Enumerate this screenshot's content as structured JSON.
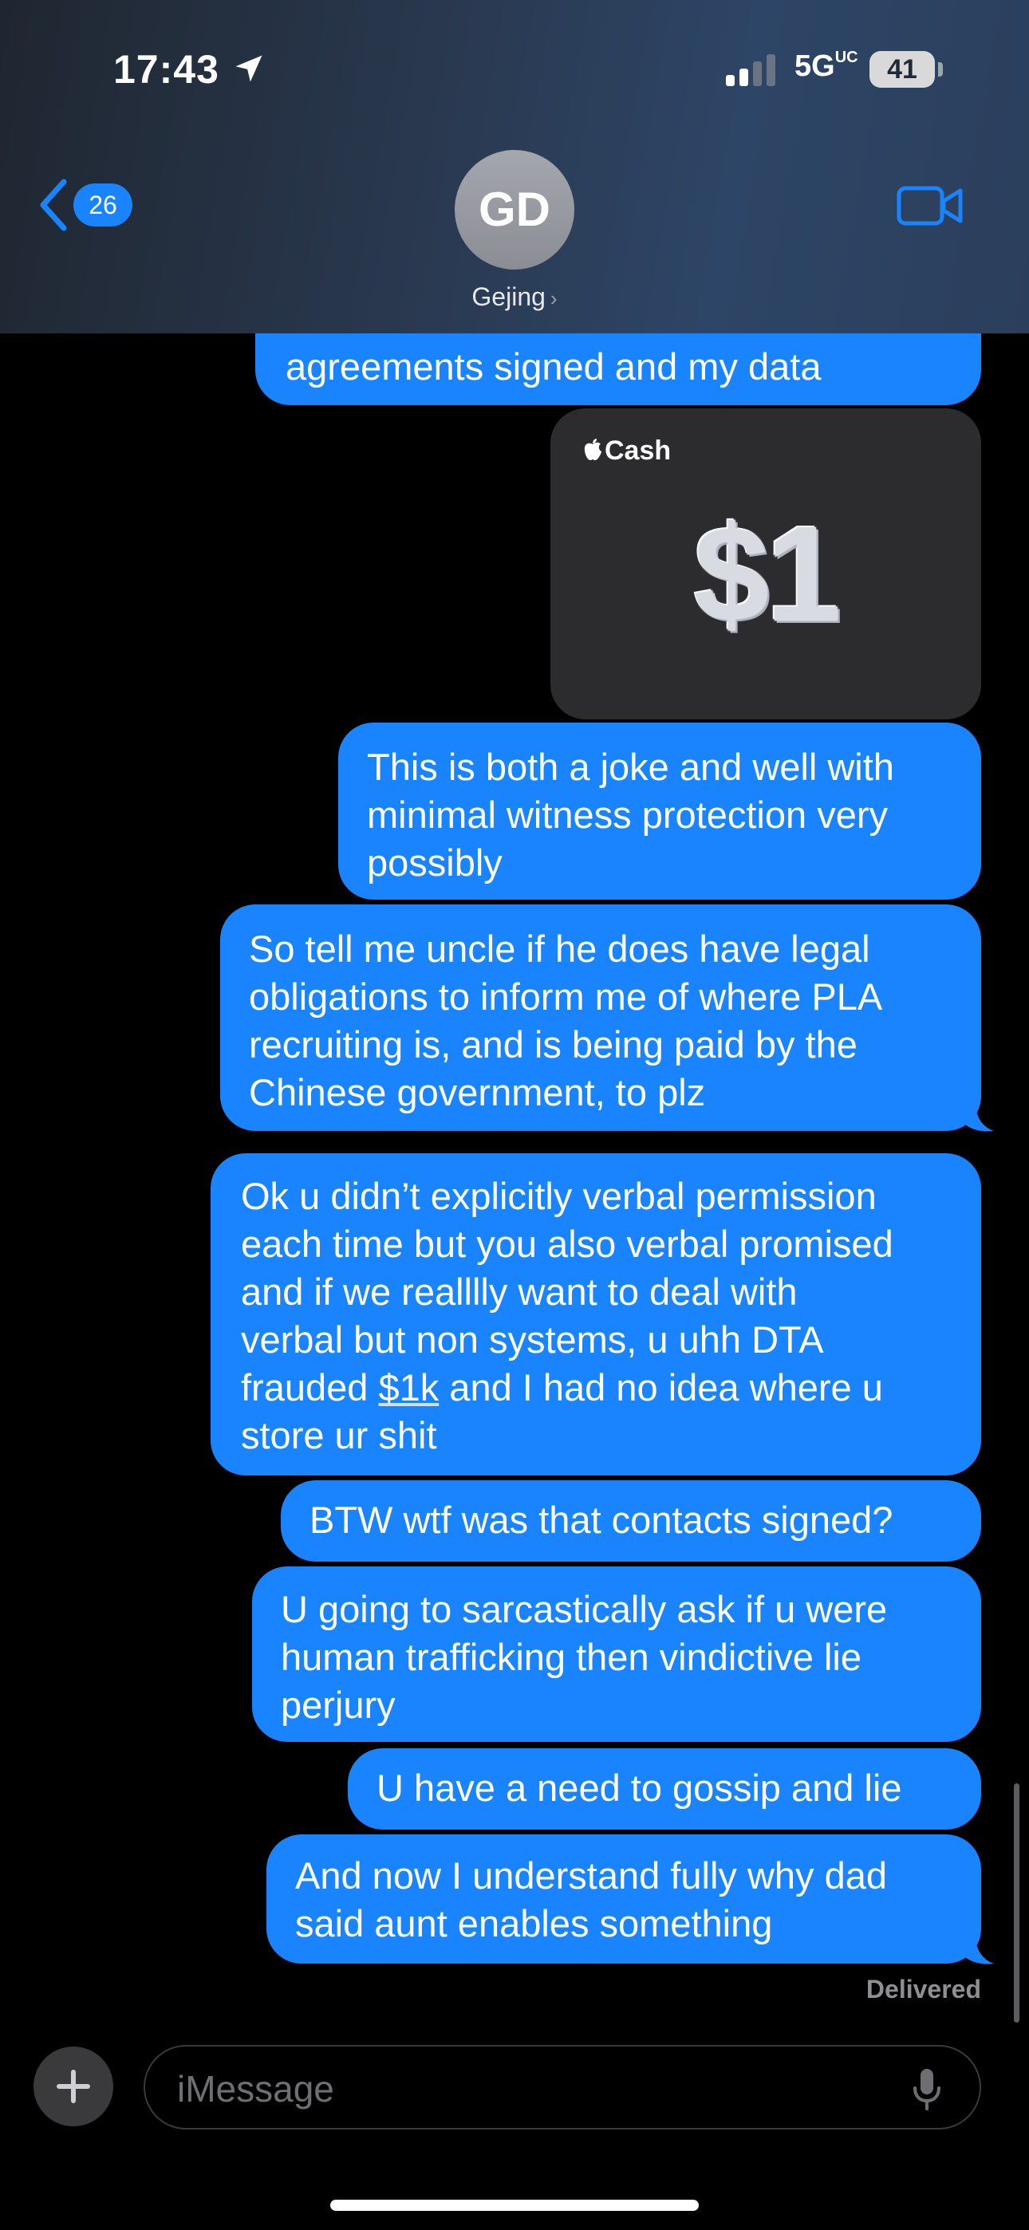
{
  "status_bar": {
    "time": "17:43",
    "network": "5G",
    "network_sub": "UC",
    "battery": "41"
  },
  "header": {
    "back_count": "26",
    "avatar_initials": "GD",
    "contact_name": "Gejing",
    "contact_chevron": "›"
  },
  "messages": {
    "m0": [
      "agreements signed and my data"
    ],
    "cash": {
      "label": "Cash",
      "amount": "$1"
    },
    "m1": [
      "This is both a joke and well with",
      "minimal witness protection very",
      "possibly"
    ],
    "m2": [
      "So tell me uncle if he does have legal",
      "obligations to inform me of where PLA",
      "recruiting is, and is being paid by the",
      "Chinese government, to plz"
    ],
    "m3": {
      "l1": "Ok u didn’t explicitly verbal permission",
      "l2": "each time but you also verbal promised",
      "l3": "and if we realllly want to deal with",
      "l4": "verbal but non systems, u uhh DTA",
      "l5_pre": "frauded ",
      "l5_link": "$1k",
      "l5_post": " and I had no idea where u",
      "l6": "store ur shit"
    },
    "m4": [
      "BTW wtf was that contacts signed?"
    ],
    "m5": [
      "U going to sarcastically ask if u were",
      "human trafficking then vindictive lie",
      "perjury"
    ],
    "m6": [
      "U have a need to gossip and lie"
    ],
    "m7": [
      "And now I understand fully why dad",
      "said aunt enables something"
    ],
    "delivered": "Delivered"
  },
  "composer": {
    "plus_label": "+",
    "placeholder": "iMessage"
  },
  "colors": {
    "bubble_blue": "#1a84ff",
    "background": "#000000",
    "cash_card": "#2c2c2e"
  }
}
